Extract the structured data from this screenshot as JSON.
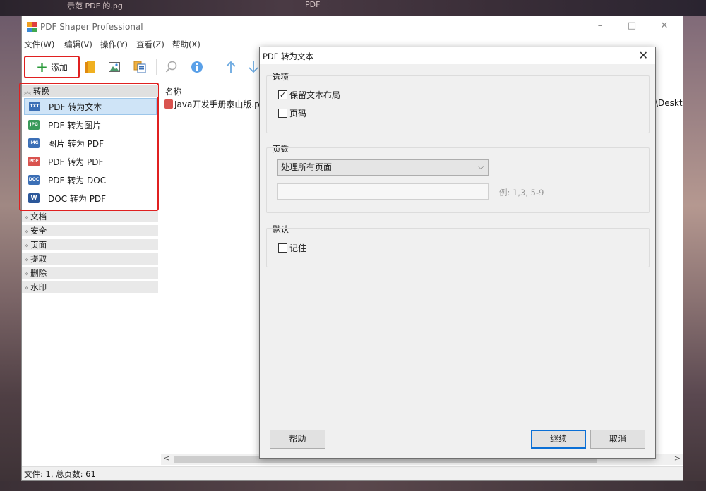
{
  "desktop": {
    "top_fragments": [
      "示范    PDF    的.pg",
      "PDF"
    ]
  },
  "window": {
    "title": "PDF Shaper Professional",
    "controls": {
      "minimize": "–",
      "maximize": "□",
      "close": "✕"
    }
  },
  "menu": [
    "文件(W)",
    "编辑(V)",
    "操作(Y)",
    "查看(Z)",
    "帮助(X)"
  ],
  "toolbar": {
    "add_label": "添加",
    "icons": [
      "folder-icon",
      "image-icon",
      "copy-icon",
      "search-icon",
      "info-icon",
      "arrow-up-icon",
      "arrow-down-icon"
    ]
  },
  "sidebar": {
    "convert_group": "转换",
    "convert_items": [
      {
        "label": "PDF 转为文本",
        "icon": "txt",
        "color": "#3b6fb6",
        "selected": true
      },
      {
        "label": "PDF 转为图片",
        "icon": "jpg",
        "color": "#3a9a5a",
        "selected": false
      },
      {
        "label": "图片 转为 PDF",
        "icon": "img",
        "color": "#3b6fb6",
        "selected": false
      },
      {
        "label": "PDF 转为 PDF",
        "icon": "pdf",
        "color": "#d9534f",
        "selected": false
      },
      {
        "label": "PDF 转为 DOC",
        "icon": "doc",
        "color": "#3b6fb6",
        "selected": false
      },
      {
        "label": "DOC 转为 PDF",
        "icon": "w",
        "color": "#2b579a",
        "selected": false
      }
    ],
    "other_groups": [
      "文档",
      "安全",
      "页面",
      "提取",
      "删除",
      "水印"
    ]
  },
  "file_list": {
    "column_name": "名称",
    "files": [
      {
        "name": "Java开发手册泰山版.p"
      }
    ],
    "path_fragment": "\\Deskt"
  },
  "status": {
    "text": "文件: 1, 总页数: 61"
  },
  "dialog": {
    "title": "PDF 转为文本",
    "options_label": "选项",
    "keep_layout": {
      "label": "保留文本布局",
      "checked": true
    },
    "page_numbers": {
      "label": "页码",
      "checked": false
    },
    "pages_label": "页数",
    "pages_select": "处理所有页面",
    "pages_hint": "例: 1,3, 5-9",
    "default_label": "默认",
    "remember": {
      "label": "记住",
      "checked": false
    },
    "help_button": "帮助",
    "continue_button": "继续",
    "cancel_button": "取消"
  },
  "colors": {
    "highlight_red": "#e02020",
    "selection_blue": "#cfe4f7",
    "primary_button_border": "#0a6fd6"
  }
}
